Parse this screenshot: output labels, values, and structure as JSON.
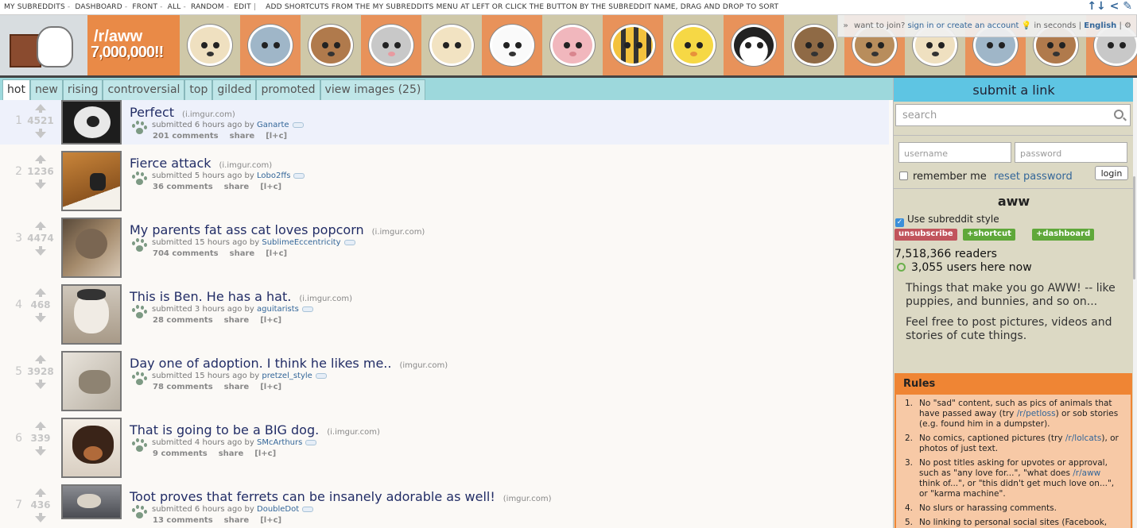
{
  "topbar": {
    "links": [
      "MY SUBREDDITS",
      "DASHBOARD",
      "FRONT",
      "ALL",
      "RANDOM",
      "EDIT"
    ],
    "note": "add shortcuts from the my subreddits menu at left or click the button by the subreddit name, drag and drop to sort",
    "tools": "↑↓ </"
  },
  "header": {
    "brand_name": "/r/aww",
    "brand_count": "7,000,000!!"
  },
  "userbar": {
    "arrow": "»",
    "want_to_join": "want to join?",
    "signin": "sign in or create an account",
    "seconds": "in seconds",
    "language": "English"
  },
  "tabs": [
    {
      "label": "hot",
      "selected": true
    },
    {
      "label": "new"
    },
    {
      "label": "rising"
    },
    {
      "label": "controversial"
    },
    {
      "label": "top"
    },
    {
      "label": "gilded"
    },
    {
      "label": "promoted"
    },
    {
      "label": "view images (25)"
    }
  ],
  "posts": [
    {
      "rank": "1",
      "score": "4521",
      "title": "Perfect",
      "domain": "(i.imgur.com)",
      "time": "submitted 6 hours ago by",
      "author": "Ganarte",
      "comments": "201 comments"
    },
    {
      "rank": "2",
      "score": "1236",
      "title": "Fierce attack",
      "domain": "(i.imgur.com)",
      "time": "submitted 5 hours ago by",
      "author": "Lobo2ffs",
      "comments": "36 comments"
    },
    {
      "rank": "3",
      "score": "4474",
      "title": "My parents fat ass cat loves popcorn",
      "domain": "(i.imgur.com)",
      "time": "submitted 15 hours ago by",
      "author": "SublimeEccentricity",
      "comments": "704 comments"
    },
    {
      "rank": "4",
      "score": "468",
      "title": "This is Ben. He has a hat.",
      "domain": "(i.imgur.com)",
      "time": "submitted 3 hours ago by",
      "author": "aguitarists",
      "comments": "28 comments"
    },
    {
      "rank": "5",
      "score": "3928",
      "title": "Day one of adoption. I think he likes me..",
      "domain": "(imgur.com)",
      "time": "submitted 15 hours ago by",
      "author": "pretzel_style",
      "comments": "78 comments"
    },
    {
      "rank": "6",
      "score": "339",
      "title": "That is going to be a BIG dog.",
      "domain": "(i.imgur.com)",
      "time": "submitted 4 hours ago by",
      "author": "SMcArthurs",
      "comments": "9 comments"
    },
    {
      "rank": "7",
      "score": "436",
      "title": "Toot proves that ferrets can be insanely adorable as well!",
      "domain": "(imgur.com)",
      "time": "submitted 6 hours ago by",
      "author": "DoubleDot",
      "comments": "13 comments"
    }
  ],
  "post_buttons": {
    "share": "share",
    "lc": "[l+c]"
  },
  "sidebar": {
    "submit_link": "submit a link",
    "search_placeholder": "search",
    "username_placeholder": "username",
    "password_placeholder": "password",
    "remember_me": "remember me",
    "reset_password": "reset password",
    "login": "login",
    "subreddit_name": "aww",
    "use_style": "Use subreddit style",
    "unsubscribe": "unsubscribe",
    "shortcut": "+shortcut",
    "dashboard": "+dashboard",
    "readers": "7,518,366 readers",
    "online": "3,055 users here now",
    "description": [
      "Things that make you go AWW! -- like puppies, and bunnies, and so on...",
      "Feel free to post pictures, videos and stories of cute things."
    ],
    "rules_title": "Rules",
    "rules": [
      {
        "num": "1.",
        "pre": "No \"sad\" content, such as pics of animals that have passed away (try ",
        "link": "/r/petloss",
        "post": ") or sob stories (e.g. found him in a dumpster)."
      },
      {
        "num": "2.",
        "pre": "No comics, captioned pictures (try ",
        "link": "/r/lolcats",
        "post": "), or photos of just text."
      },
      {
        "num": "3.",
        "pre": "No post titles asking for upvotes or approval, such as \"any love for...\", \"what does ",
        "link": "/r/aww",
        "post": " think of...\", or \"this didn't get much love on...\", or \"karma machine\"."
      },
      {
        "num": "4.",
        "pre": "No slurs or harassing comments.",
        "link": "",
        "post": ""
      },
      {
        "num": "5.",
        "pre": "No linking to personal social sites (Facebook, Twitter, etc).",
        "link": "",
        "post": ""
      }
    ]
  },
  "colors": {
    "tab_bar": "#9dd8dc",
    "sidebar_bg": "#dcd9c4",
    "submit_link_bg": "#5ec5e3",
    "rules_bg": "#f7c9a6",
    "rules_header": "#ef8534",
    "unsubscribe": "#c1545c",
    "shortcut": "#5fa83a",
    "link": "#336699"
  },
  "icons": {
    "search": "search-icon",
    "vote_up": "upvote-arrow-icon",
    "vote_down": "downvote-arrow-icon",
    "paw": "paw-icon",
    "sort": "sort-arrows-icon",
    "edit": "edit-pencil-icon"
  }
}
